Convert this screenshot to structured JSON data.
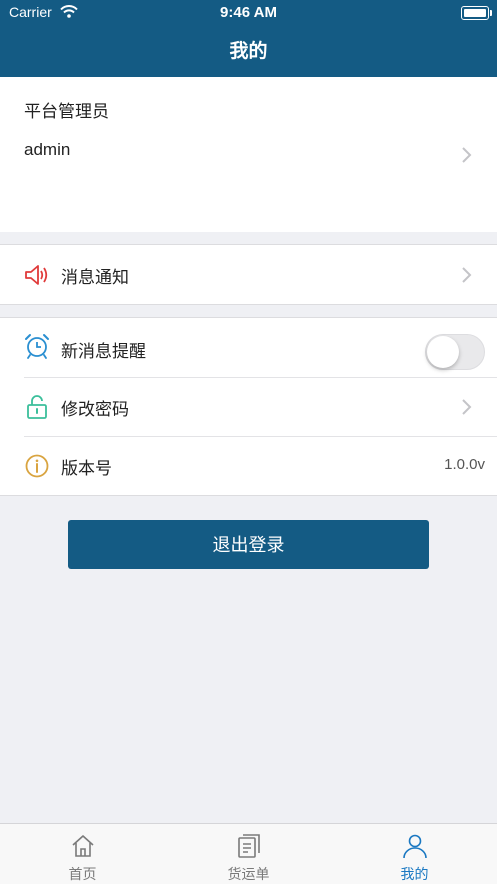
{
  "status_bar": {
    "carrier": "Carrier",
    "time": "9:46 AM"
  },
  "header": {
    "title": "我的"
  },
  "profile": {
    "role": "平台管理员",
    "username": "admin"
  },
  "menu": {
    "notifications": {
      "label": "消息通知",
      "icon": "speaker-icon"
    },
    "new_message_alert": {
      "label": "新消息提醒",
      "icon": "alarm-clock-icon",
      "enabled": false
    },
    "change_password": {
      "label": "修改密码",
      "icon": "unlock-icon"
    },
    "version": {
      "label": "版本号",
      "icon": "info-icon",
      "value": "1.0.0v"
    }
  },
  "logout_label": "退出登录",
  "tabbar": {
    "items": [
      {
        "label": "首页",
        "icon": "home-icon",
        "active": false
      },
      {
        "label": "货运单",
        "icon": "document-list-icon",
        "active": false
      },
      {
        "label": "我的",
        "icon": "user-icon",
        "active": true
      }
    ]
  },
  "colors": {
    "primary": "#145b84",
    "tab_active": "#1a78c2",
    "tab_inactive": "#7a7a7a",
    "speaker": "#e03b3b",
    "alarm": "#2a8fd1",
    "unlock": "#3bbf9b",
    "info": "#d9a440"
  }
}
